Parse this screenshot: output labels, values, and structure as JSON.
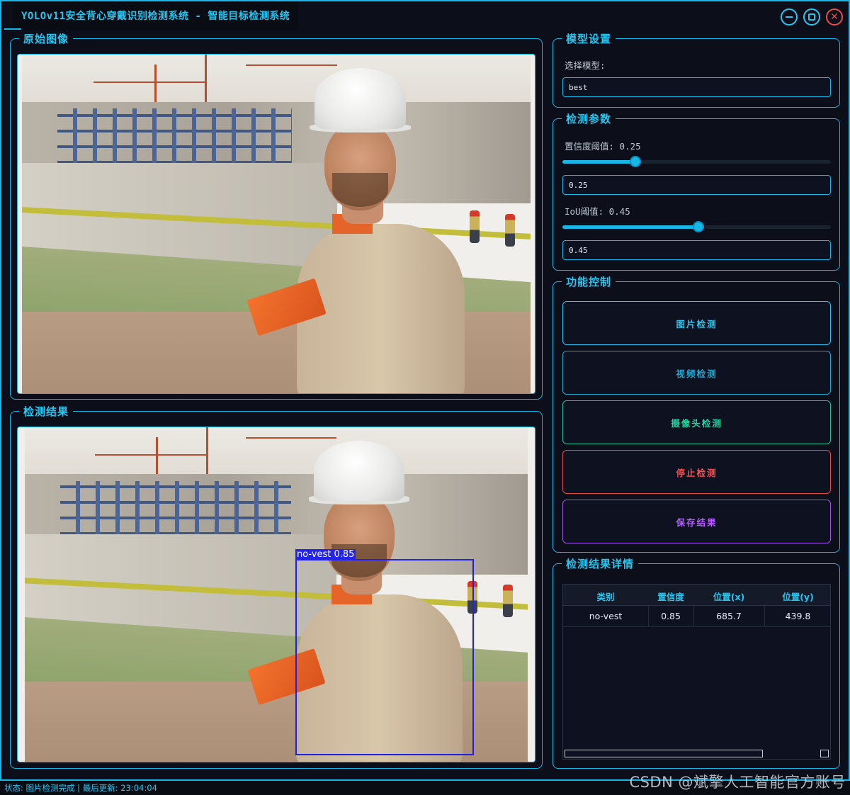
{
  "window": {
    "title": "YOLOv11安全背心穿戴识别检测系统 - 智能目标检测系统"
  },
  "panels": {
    "original": {
      "title": "原始图像"
    },
    "result": {
      "title": "检测结果"
    },
    "model": {
      "title": "模型设置",
      "select_label": "选择模型:",
      "model_value": "best"
    },
    "params": {
      "title": "检测参数",
      "confidence_label": "置信度阈值: 0.25",
      "confidence_value": "0.25",
      "confidence_level": 0.25,
      "iou_label": "IoU阈值: 0.45",
      "iou_value": "0.45",
      "iou_level": 0.45
    },
    "controls": {
      "title": "功能控制",
      "image_detect": "图片检测",
      "video_detect": "视频检测",
      "camera_detect": "摄像头检测",
      "stop_detect": "停止检测",
      "save_result": "保存结果"
    },
    "details": {
      "title": "检测结果详情",
      "columns": [
        "类别",
        "置信度",
        "位置(x)",
        "位置(y)"
      ],
      "rows": [
        [
          "no-vest",
          "0.85",
          "685.7",
          "439.8"
        ]
      ]
    }
  },
  "detection": {
    "label": "no-vest 0.85"
  },
  "colors": {
    "accent": "#16b6e6",
    "image_btn": "#27c6f1",
    "camera_btn": "#22d3a0",
    "stop_btn": "#ff4d4d",
    "save_btn": "#b45cff"
  },
  "status": {
    "text": "状态: 图片检测完成 | 最后更新: 23:04:04"
  },
  "watermark": "CSDN @斌擎人工智能官方账号"
}
